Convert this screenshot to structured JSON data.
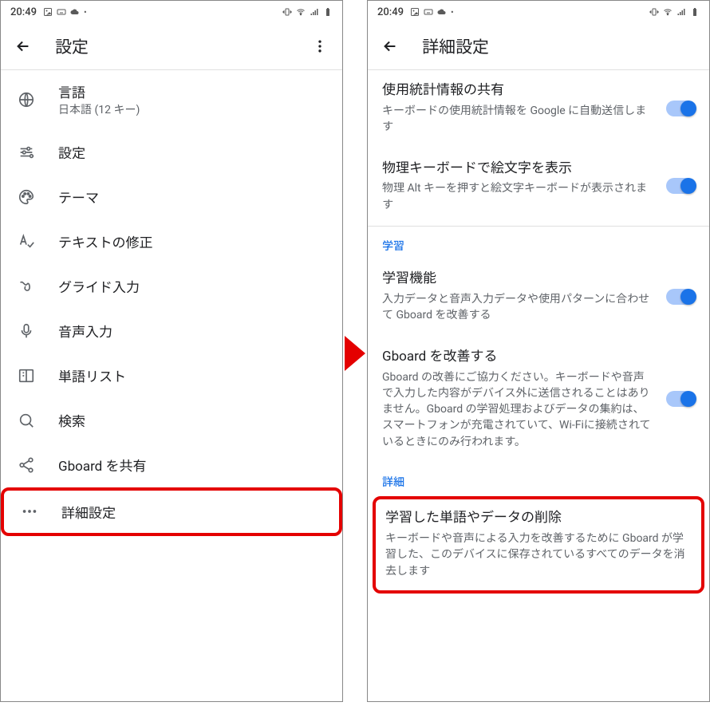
{
  "statusbar": {
    "time": "20:49"
  },
  "left": {
    "title": "設定",
    "items": [
      {
        "label": "言語",
        "sub": "日本語 (12 キー)"
      },
      {
        "label": "設定"
      },
      {
        "label": "テーマ"
      },
      {
        "label": "テキストの修正"
      },
      {
        "label": "グライド入力"
      },
      {
        "label": "音声入力"
      },
      {
        "label": "単語リスト"
      },
      {
        "label": "検索"
      },
      {
        "label": "Gboard を共有"
      },
      {
        "label": "詳細設定"
      }
    ]
  },
  "right": {
    "title": "詳細設定",
    "settings": [
      {
        "title": "使用統計情報の共有",
        "desc": "キーボードの使用統計情報を Google に自動送信します"
      },
      {
        "title": "物理キーボードで絵文字を表示",
        "desc": "物理 Alt キーを押すと絵文字キーボードが表示されます"
      }
    ],
    "sections": {
      "learning": "学習",
      "details": "詳細"
    },
    "learning_items": [
      {
        "title": "学習機能",
        "desc": "入力データと音声入力データや使用パターンに合わせて Gboard を改善する"
      },
      {
        "title": "Gboard を改善する",
        "desc": "Gboard の改善にご協力ください。キーボードや音声で入力した内容がデバイス外に送信されることはありません。Gboard の学習処理およびデータの集約は、スマートフォンが充電されていて、Wi-Fiに接続されているときにのみ行われます。"
      }
    ],
    "delete_item": {
      "title": "学習した単語やデータの削除",
      "desc": "キーボードや音声による入力を改善するために Gboard が学習した、このデバイスに保存されているすべてのデータを消去します"
    }
  }
}
